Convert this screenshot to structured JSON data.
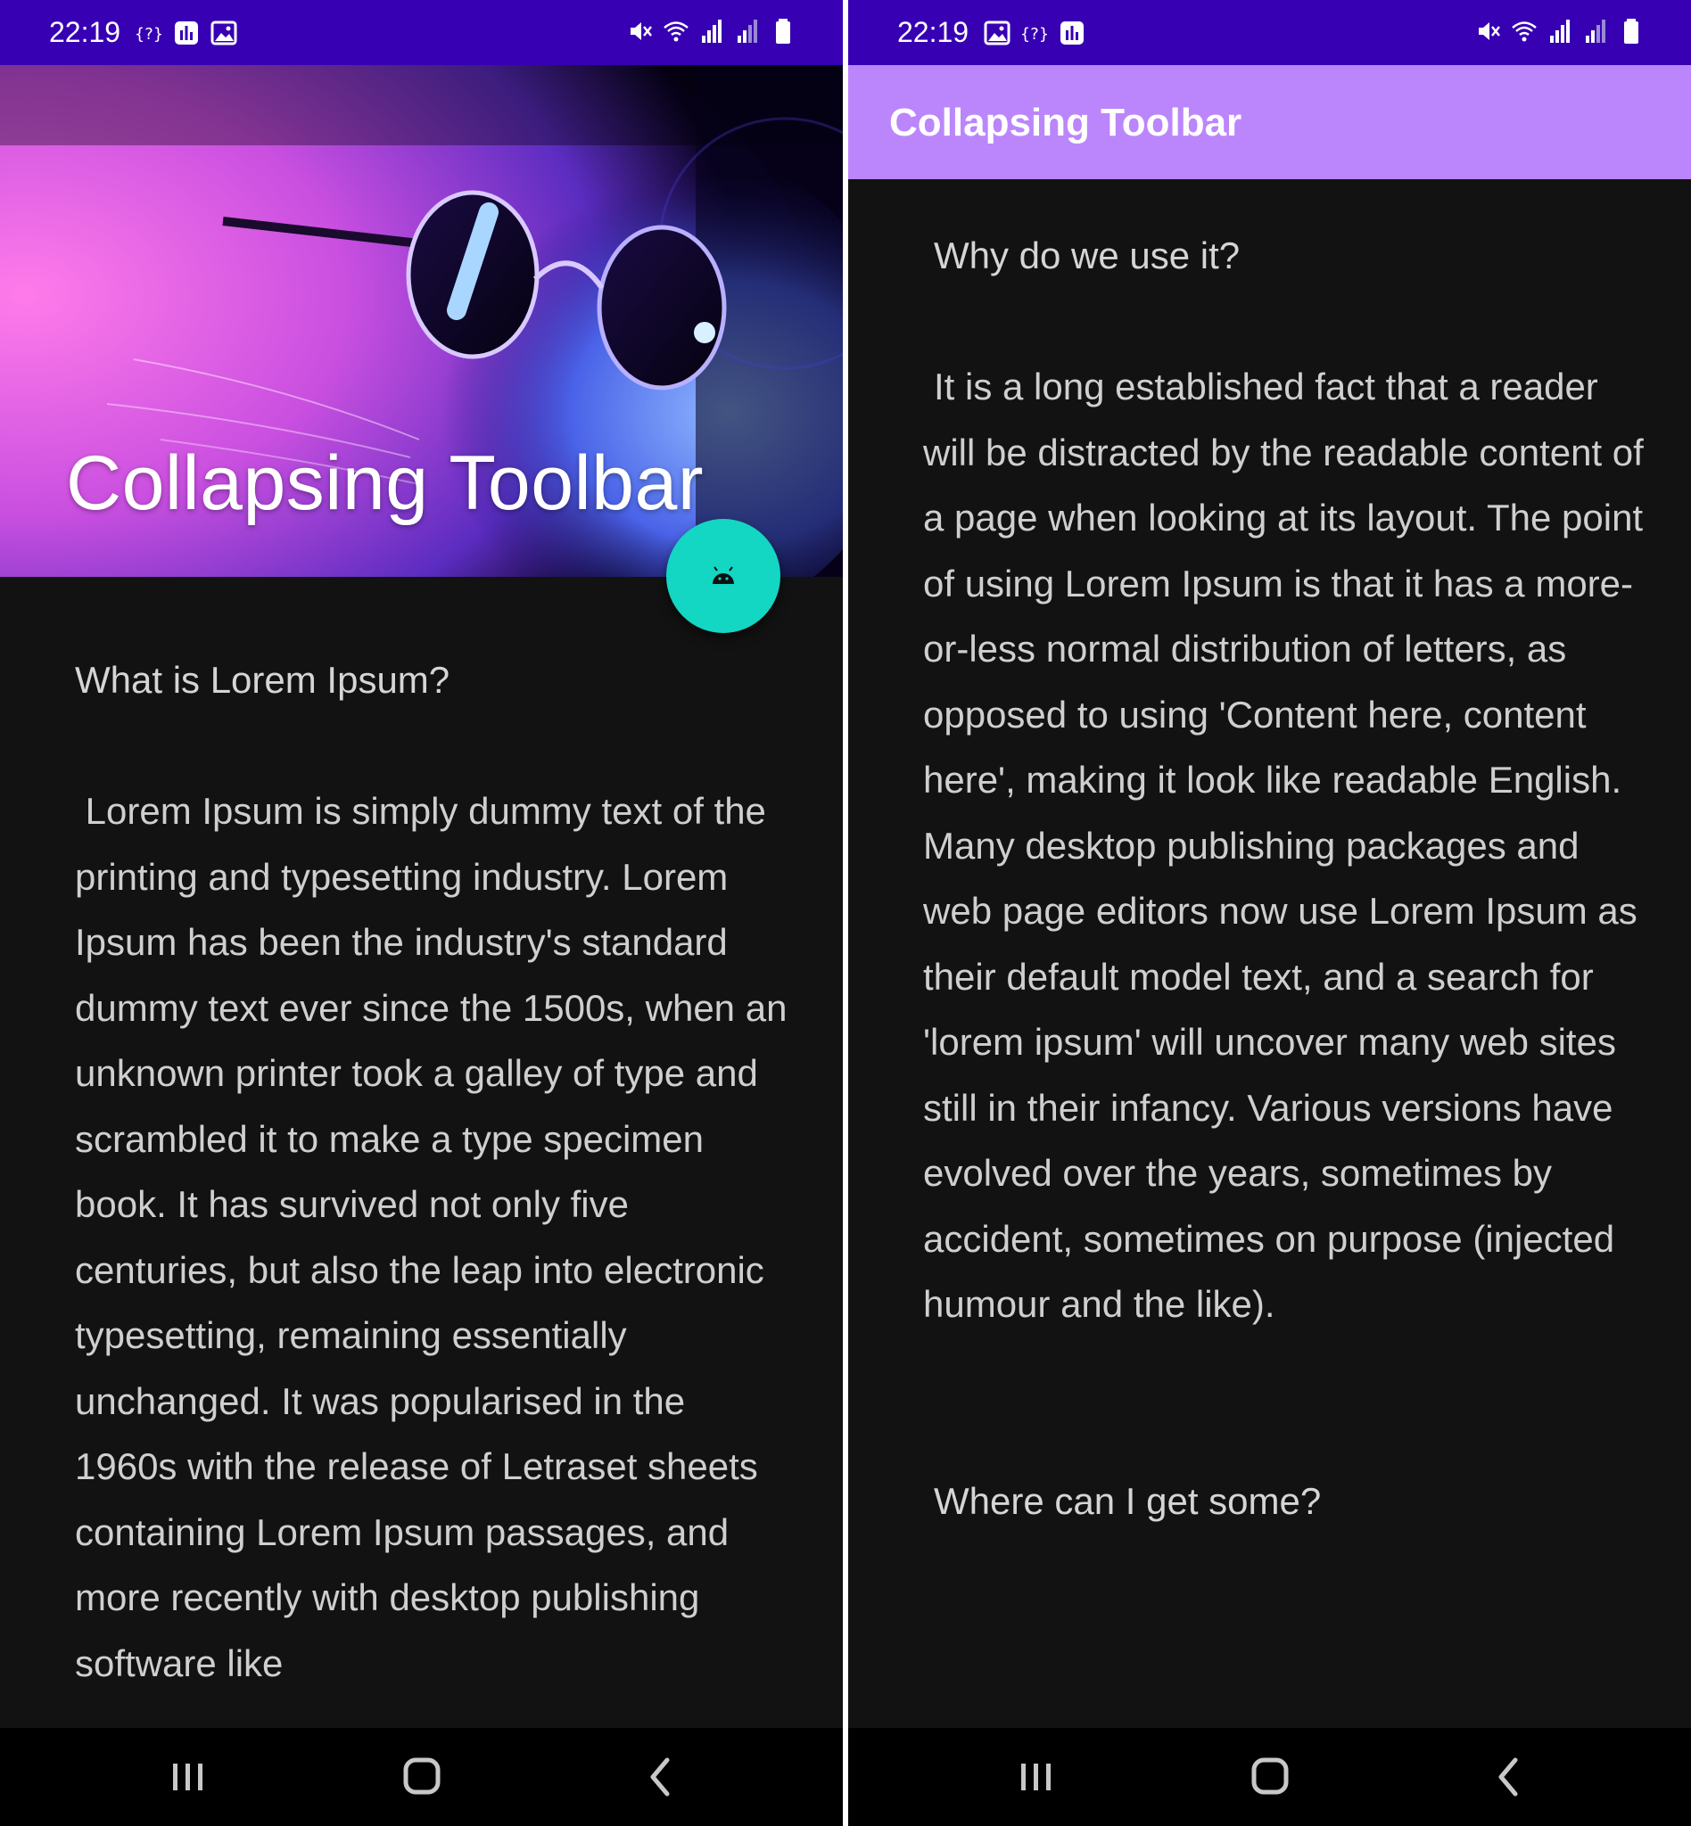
{
  "left_screen": {
    "status_bar": {
      "time": "22:19",
      "left_icons": [
        "help-icon",
        "stats-icon",
        "image-icon"
      ],
      "right_icons": [
        "mute-icon",
        "wifi-icon",
        "signal-icon",
        "signal-icon",
        "battery-icon"
      ],
      "background": "#3700b3"
    },
    "header": {
      "title": "Collapsing Toolbar",
      "image": "cat-with-sunglasses-image"
    },
    "fab": {
      "icon": "android-icon",
      "color": "#13d6c3"
    },
    "content": {
      "heading": "What is Lorem Ipsum?",
      "paragraph": " Lorem Ipsum is simply dummy text of the printing and typesetting industry. Lorem Ipsum has been the industry's standard dummy text ever since the 1500s, when an unknown printer took a galley of type and scrambled it to make a type specimen book. It has survived not only five centuries, but also the leap into electronic typesetting, remaining essentially unchanged. It was popularised in the 1960s with the release of Letraset sheets containing Lorem Ipsum passages, and more recently with desktop publishing software like"
    },
    "nav_bar": {
      "buttons": [
        "recents-icon",
        "home-icon",
        "back-icon"
      ]
    }
  },
  "right_screen": {
    "status_bar": {
      "time": "22:19",
      "left_icons": [
        "image-icon",
        "help-icon",
        "stats-icon"
      ],
      "right_icons": [
        "mute-icon",
        "wifi-icon",
        "signal-icon",
        "signal-icon",
        "battery-icon"
      ],
      "background": "#3700b3"
    },
    "app_bar": {
      "title": "Collapsing Toolbar",
      "background": "#bb86fc"
    },
    "content": {
      "heading": "Why do we use it?",
      "paragraph": "It is a long established fact that a reader will be distracted by the readable content of a page when looking at its layout. The point of using Lorem Ipsum is that it has a more-or-less normal distribution of letters, as opposed to using 'Content here, content here', making it look like readable English. Many desktop publishing packages and web page editors now use Lorem Ipsum as their default model text, and a search for 'lorem ipsum' will uncover many web sites still in their infancy. Various versions have evolved over the years, sometimes by accident, sometimes on purpose (injected humour and the like).",
      "next_heading": "Where can I get some?"
    },
    "nav_bar": {
      "buttons": [
        "recents-icon",
        "home-icon",
        "back-icon"
      ]
    }
  }
}
